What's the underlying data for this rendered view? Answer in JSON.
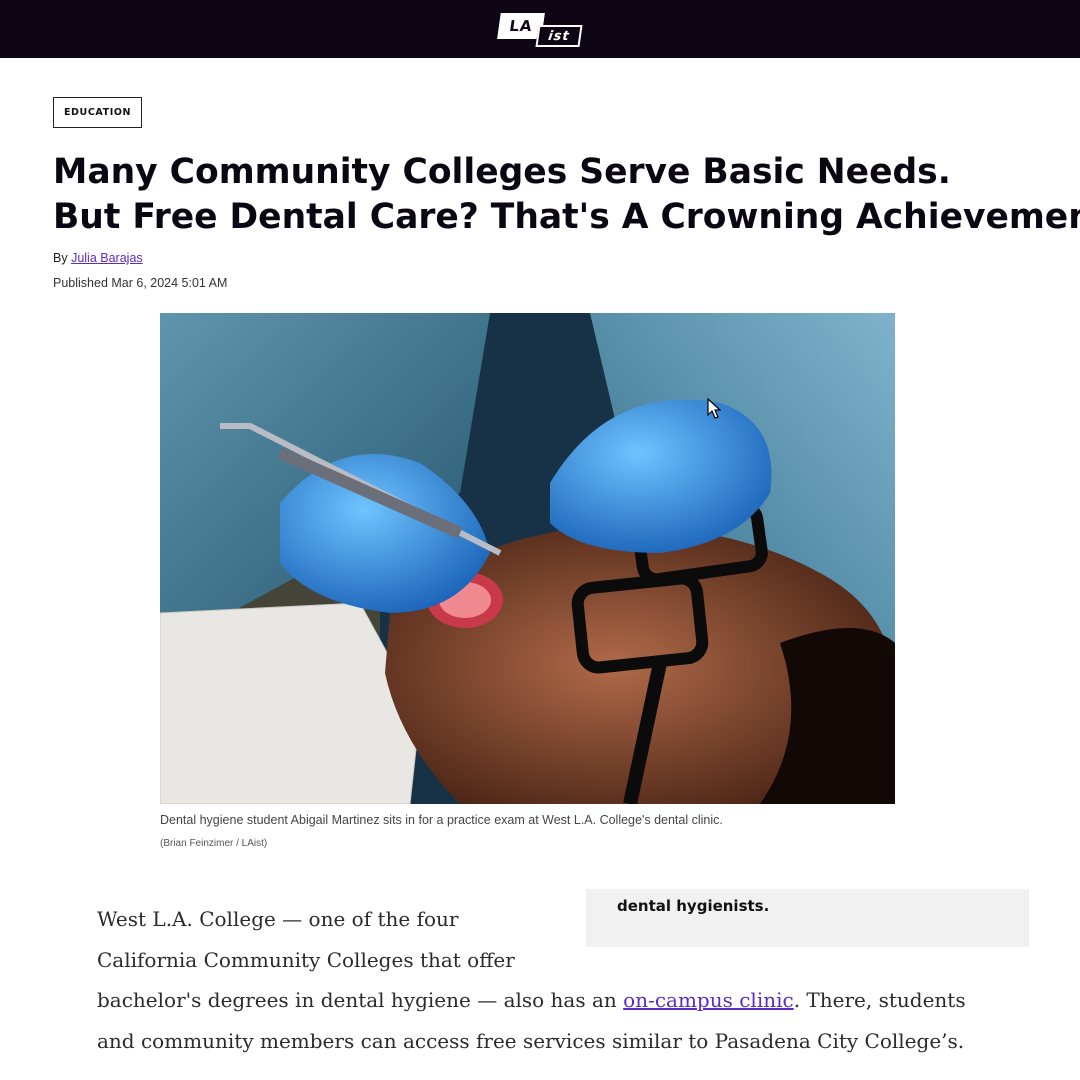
{
  "site": {
    "logo_top": "LA",
    "logo_bottom": "ist"
  },
  "article": {
    "category": "EDUCATION",
    "headline_line1": "Many Community Colleges Serve Basic Needs.",
    "headline_line2": "But Free Dental Care? That's A Crowning Achievement",
    "byline_prefix": "By",
    "author": "Julia Barajas",
    "published": "Published Mar 6, 2024 5:01 AM",
    "image_caption": "Dental hygiene student Abigail Martinez sits in for a practice exam at West L.A. College's dental clinic.",
    "image_credit": "(Brian Feinzimer /  LAist)",
    "pullout_text": "dental hygienists.",
    "body": {
      "line1": "West L.A. College — one of the four",
      "line2": "California Community Colleges that offer",
      "line3_before": "bachelor's degrees in dental hygiene — also has an ",
      "line3_link": "on-campus clinic",
      "line3_after": ". There, students",
      "line4": "and community members can access free services similar to Pasadena City College’s."
    }
  },
  "colors": {
    "header_bg": "#0e0614",
    "link": "#5b2bc4",
    "pullout_bg": "#f1f1f1"
  }
}
